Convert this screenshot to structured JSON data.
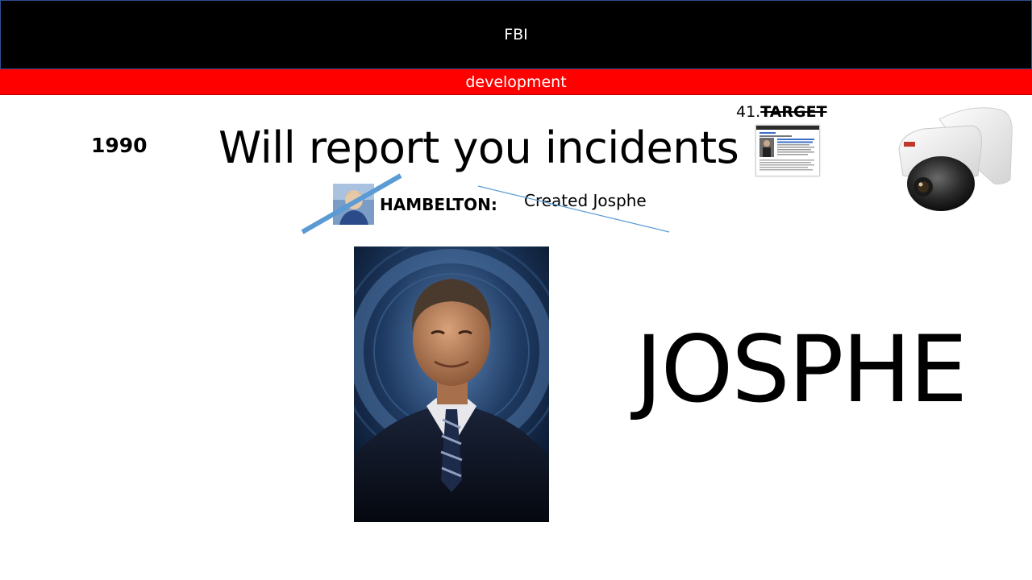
{
  "header": {
    "title": "FBI",
    "background": "#000000",
    "text_color": "#ffffff"
  },
  "subheader": {
    "label": "development",
    "background": "#ff0000",
    "text_color": "#ffffff"
  },
  "content": {
    "year": "1990",
    "headline": "Will report you incidents",
    "target_number": "41.",
    "target_label": "TARGET",
    "person_label": "HAMBELTON:",
    "created_text": "Created Josphe",
    "big_name": "JOSPHE",
    "accent_line_color": "#5b9bd5"
  },
  "images": {
    "document_thumbnail": "news-article-thumbnail",
    "camera": "dome-security-camera",
    "small_photo": "person-headshot-crossed-out",
    "portrait": "official-portrait-with-seal"
  }
}
